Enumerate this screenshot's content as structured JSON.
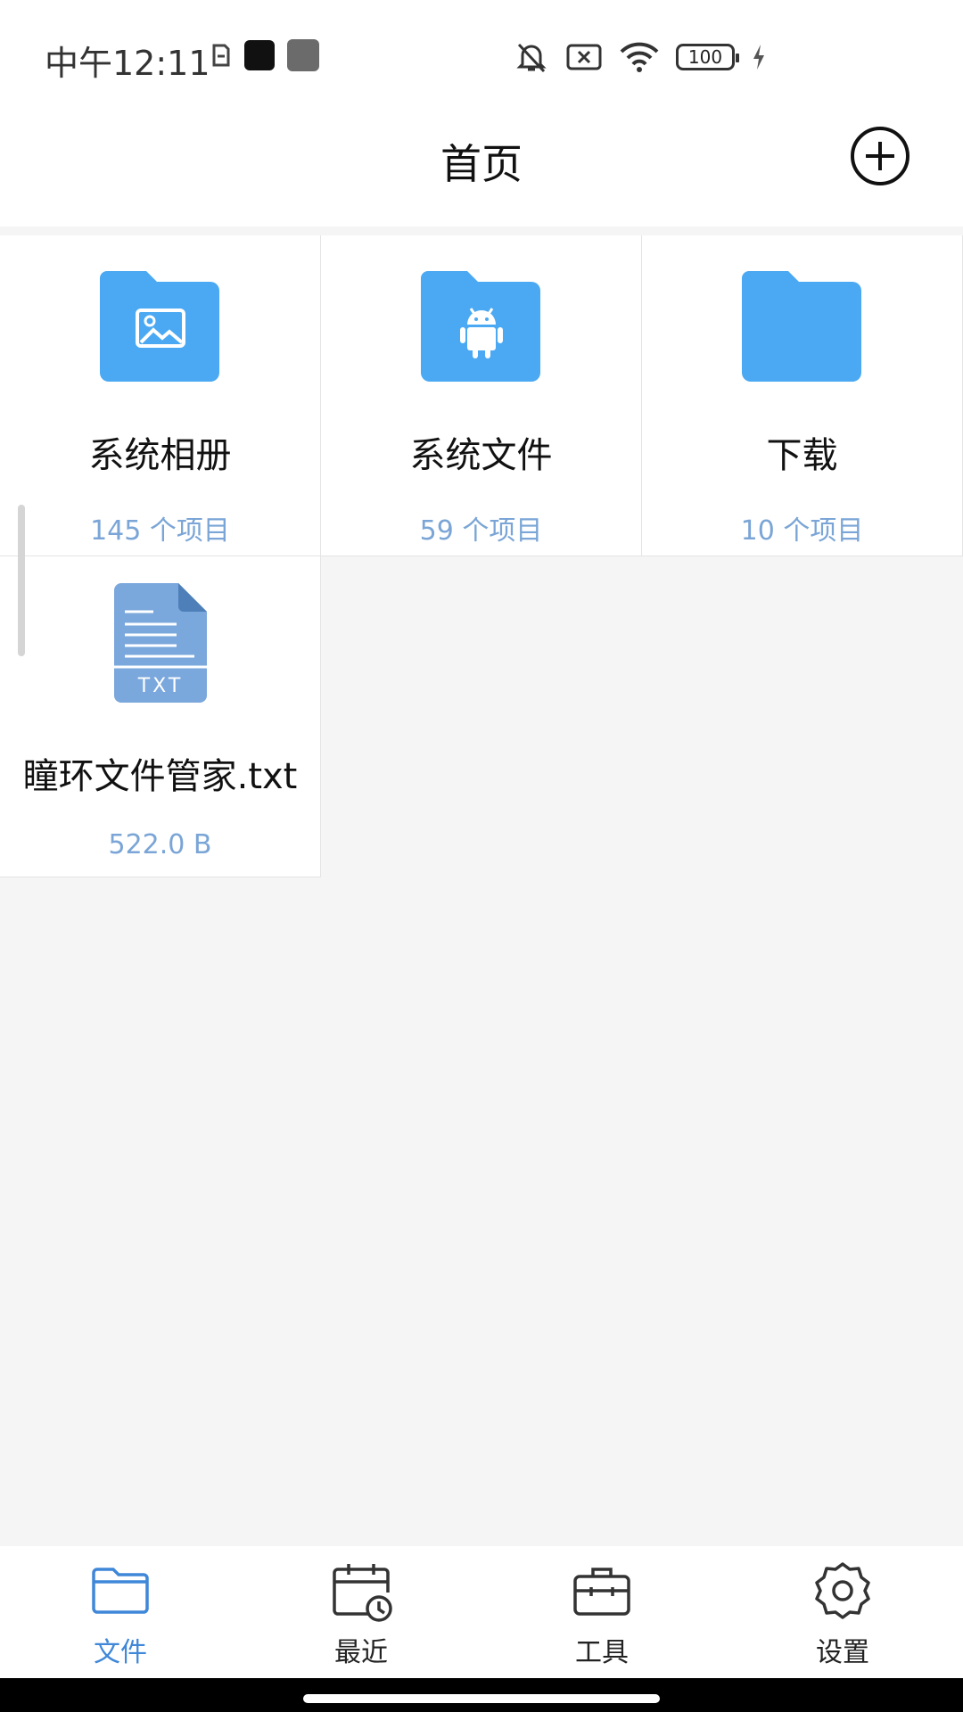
{
  "status_bar": {
    "time": "中午12:11",
    "icons": [
      "sim-icon",
      "notification-black-icon",
      "notification-gray-icon",
      "mute-icon",
      "no-sim-icon",
      "wifi-icon",
      "battery-icon",
      "charging-icon"
    ],
    "battery_level": "100"
  },
  "header": {
    "title": "首页",
    "add_icon": "plus-circle-icon"
  },
  "items": [
    {
      "name": "系统相册",
      "subtitle": "145 个项目",
      "icon": "folder-image-icon"
    },
    {
      "name": "系统文件",
      "subtitle": "59 个项目",
      "icon": "folder-android-icon"
    },
    {
      "name": "下载",
      "subtitle": "10 个项目",
      "icon": "folder-icon"
    },
    {
      "name": "瞳环文件管家.txt",
      "subtitle": "522.0 B",
      "icon": "txt-file-icon",
      "icon_label": "TXT"
    }
  ],
  "bottom_nav": [
    {
      "label": "文件",
      "icon": "folder-icon",
      "active": true
    },
    {
      "label": "最近",
      "icon": "calendar-clock-icon",
      "active": false
    },
    {
      "label": "工具",
      "icon": "toolbox-icon",
      "active": false
    },
    {
      "label": "设置",
      "icon": "gear-icon",
      "active": false
    }
  ],
  "colors": {
    "accent": "#3f87d8",
    "folder": "#4aa9f2",
    "txt_icon": "#7aa7dc",
    "subtitle": "#7aa5d6"
  }
}
